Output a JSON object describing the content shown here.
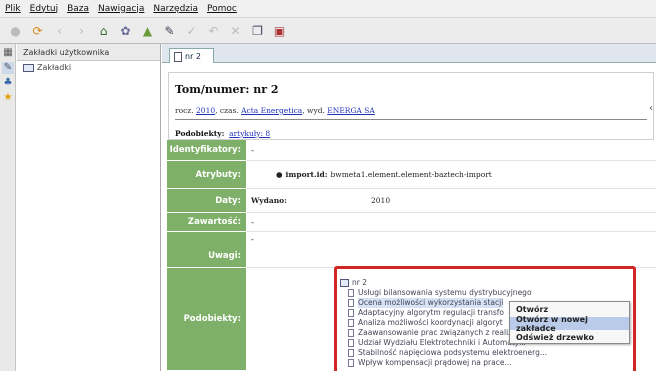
{
  "menu": [
    "Plik",
    "Edytuj",
    "Baza",
    "Nawigacja",
    "Narzędzia",
    "Pomoc"
  ],
  "bookmarks": {
    "header": "Zakładki użytkownika",
    "folder": "Zakładki"
  },
  "tab": {
    "label": "nr 2"
  },
  "record": {
    "title": "Tom/numer: nr 2",
    "sub_prefix": "rocz. ",
    "year_link": "2010",
    "sub_mid": ", czas. ",
    "journal_link": "Acta Energetica",
    "sub_wyd": ", wyd. ",
    "publisher_link": "ENERGA SA",
    "podobiekty_label": "Podobiekty:",
    "podobiekty_link": "artykuły: 8"
  },
  "fields": {
    "identyfikatory": {
      "label": "Identyfikatory:",
      "value": "-"
    },
    "atrybuty": {
      "label": "Atrybuty:",
      "key": "import.id:",
      "value": "bwmeta1.element.element-baztech-import"
    },
    "daty": {
      "label": "Daty:",
      "key": "Wydano:",
      "value": "2010"
    },
    "zawartosc": {
      "label": "Zawartość:",
      "value": "-"
    },
    "uwagi": {
      "label": "Uwagi:",
      "value": "-"
    },
    "podobiekty": {
      "label": "Podobiekty:"
    }
  },
  "tree": {
    "root": "nr 2",
    "items": [
      "Usługi bilansowania systemu dystrybucyjnego",
      "Ocena możliwości wykorzystania stacji",
      "Adaptacyjny algorytm regulacji transfo",
      "Analiza możliwości koordynacji algoryt",
      "Zaawansowanie prac związanych z realiz",
      "Udział Wydziału Elektrotechniki i Automatyki",
      "Stabilność napięciowa podsystemu elektroenerg...",
      "Wpływ kompensacji prądowej na prace..."
    ]
  },
  "context_menu": [
    "Otwórz",
    "Otwórz w nowej zakładce",
    "Odśwież drzewko"
  ]
}
